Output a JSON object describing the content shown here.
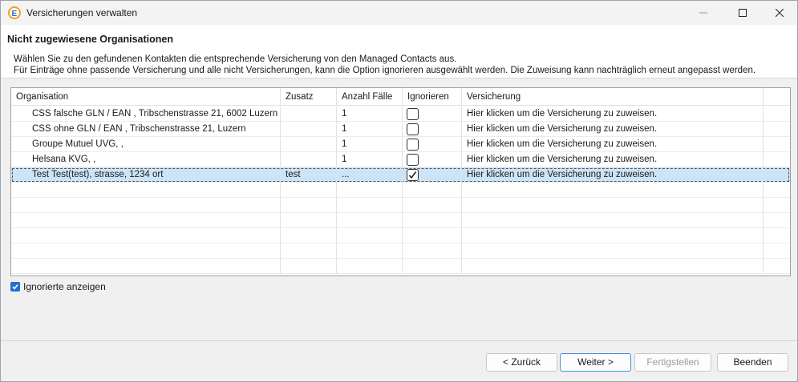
{
  "window": {
    "title": "Versicherungen verwalten"
  },
  "header": {
    "title": "Nicht zugewiesene Organisationen",
    "description_line1": "Wählen Sie zu den gefundenen Kontakten die entsprechende Versicherung von den Managed Contacts aus.",
    "description_line2": "Für Einträge ohne passende Versicherung und alle nicht Versicherungen, kann die Option ignorieren ausgewählt werden. Die Zuweisung kann nachträglich erneut angepasst werden."
  },
  "table": {
    "columns": [
      "Organisation",
      "Zusatz",
      "Anzahl Fälle",
      "Ignorieren",
      "Versicherung"
    ],
    "rows": [
      {
        "organisation": "CSS falsche GLN / EAN , Tribschenstrasse 21, 6002 Luzern",
        "zusatz": "",
        "anzahl": "1",
        "ignorieren": false,
        "versicherung": "Hier klicken um die Versicherung zu zuweisen."
      },
      {
        "organisation": "CSS ohne GLN / EAN , Tribschenstrasse 21,  Luzern",
        "zusatz": "",
        "anzahl": "1",
        "ignorieren": false,
        "versicherung": "Hier klicken um die Versicherung zu zuweisen."
      },
      {
        "organisation": "Groupe Mutuel UVG, ,",
        "zusatz": "",
        "anzahl": "1",
        "ignorieren": false,
        "versicherung": "Hier klicken um die Versicherung zu zuweisen."
      },
      {
        "organisation": "Helsana KVG, ,",
        "zusatz": "",
        "anzahl": "1",
        "ignorieren": false,
        "versicherung": "Hier klicken um die Versicherung zu zuweisen."
      },
      {
        "organisation": "Test Test(test), strasse, 1234 ort",
        "zusatz": "test",
        "anzahl": "...",
        "ignorieren": true,
        "versicherung": "Hier klicken um die Versicherung zu zuweisen.",
        "selected": true
      }
    ]
  },
  "show_ignored": {
    "label": "Ignorierte anzeigen",
    "checked": true
  },
  "buttons": {
    "back": "< Zurück",
    "next": "Weiter >",
    "finish": "Fertigstellen",
    "cancel": "Beenden"
  },
  "colors": {
    "selection": "#cce4f7",
    "checkbox_accent": "#1f6fd1"
  }
}
